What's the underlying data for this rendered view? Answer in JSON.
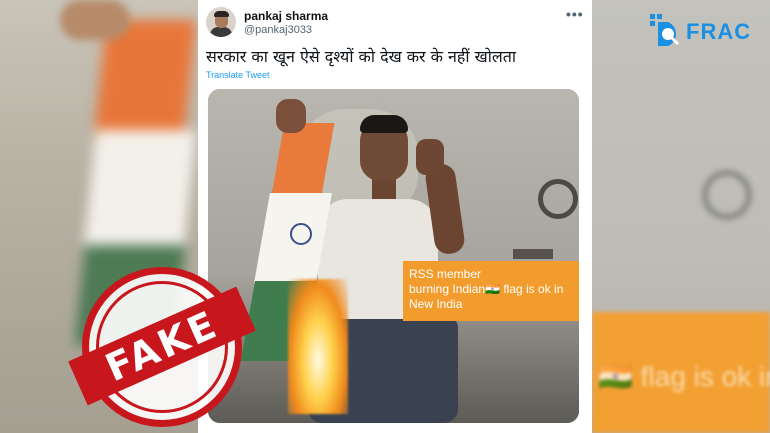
{
  "tweet": {
    "display_name": "pankaj sharma",
    "handle": "@pankaj3033",
    "more_icon": "more-horizontal-icon",
    "text": "सरकार का खून ऐसे दृश्यों को देख कर के नहीं खोलता",
    "translate_label": "Translate Tweet"
  },
  "media": {
    "caption_line1": "RSS member",
    "caption_line2": "burning Indian🇮🇳 flag is ok in",
    "caption_line3": "New India"
  },
  "background_right": {
    "ghost_text": "🇮🇳 flag is ok in"
  },
  "logo": {
    "text": "FRAC",
    "mark": "D",
    "color": "#1a8fe3"
  },
  "stamp": {
    "text": "FAKE",
    "color": "#c8161d"
  }
}
